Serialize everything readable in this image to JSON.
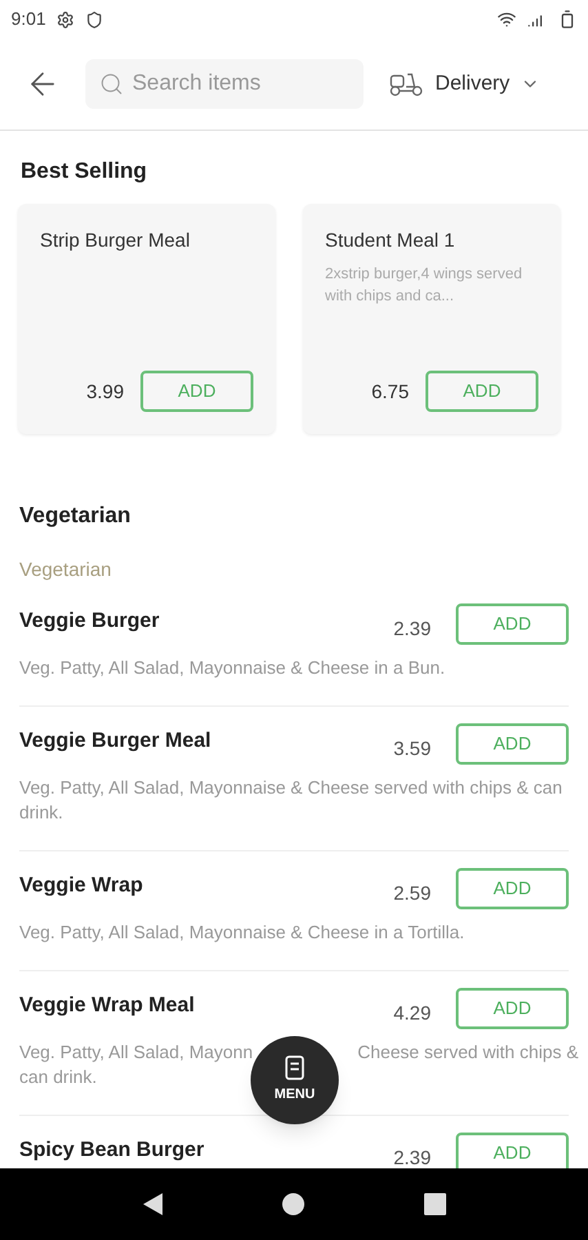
{
  "status_bar": {
    "time": "9:01"
  },
  "header": {
    "search": {
      "placeholder": "Search items"
    },
    "mode": "Delivery"
  },
  "best_selling": {
    "title": "Best Selling",
    "items": [
      {
        "name": "Strip Burger Meal",
        "price": "3.99",
        "button": "ADD"
      },
      {
        "name": "Student Meal 1",
        "description": "2xstrip burger,4 wings served with chips and ca...",
        "price": "6.75",
        "button": "ADD"
      }
    ]
  },
  "section": {
    "title": "Vegetarian",
    "subtitle": "Vegetarian",
    "items": [
      {
        "name": "Veggie Burger",
        "price": "2.39",
        "button": "ADD",
        "description": "Veg. Patty, All Salad, Mayonnaise & Cheese in a Bun."
      },
      {
        "name": "Veggie Burger Meal",
        "price": "3.59",
        "button": "ADD",
        "description": "Veg. Patty, All Salad, Mayonnaise & Cheese served with chips & can drink."
      },
      {
        "name": "Veggie Wrap",
        "price": "2.59",
        "button": "ADD",
        "description": "Veg. Patty, All Salad, Mayonnaise & Cheese in a Tortilla."
      },
      {
        "name": "Veggie Wrap Meal",
        "price": "4.29",
        "button": "ADD",
        "description_parts": [
          "Veg. Patty, All Salad, Mayonn",
          "Cheese served with chips &",
          "can drink."
        ]
      },
      {
        "name": "Spicy Bean Burger",
        "price": "2.39",
        "button": "ADD"
      }
    ]
  },
  "fab": {
    "label": "MENU"
  }
}
